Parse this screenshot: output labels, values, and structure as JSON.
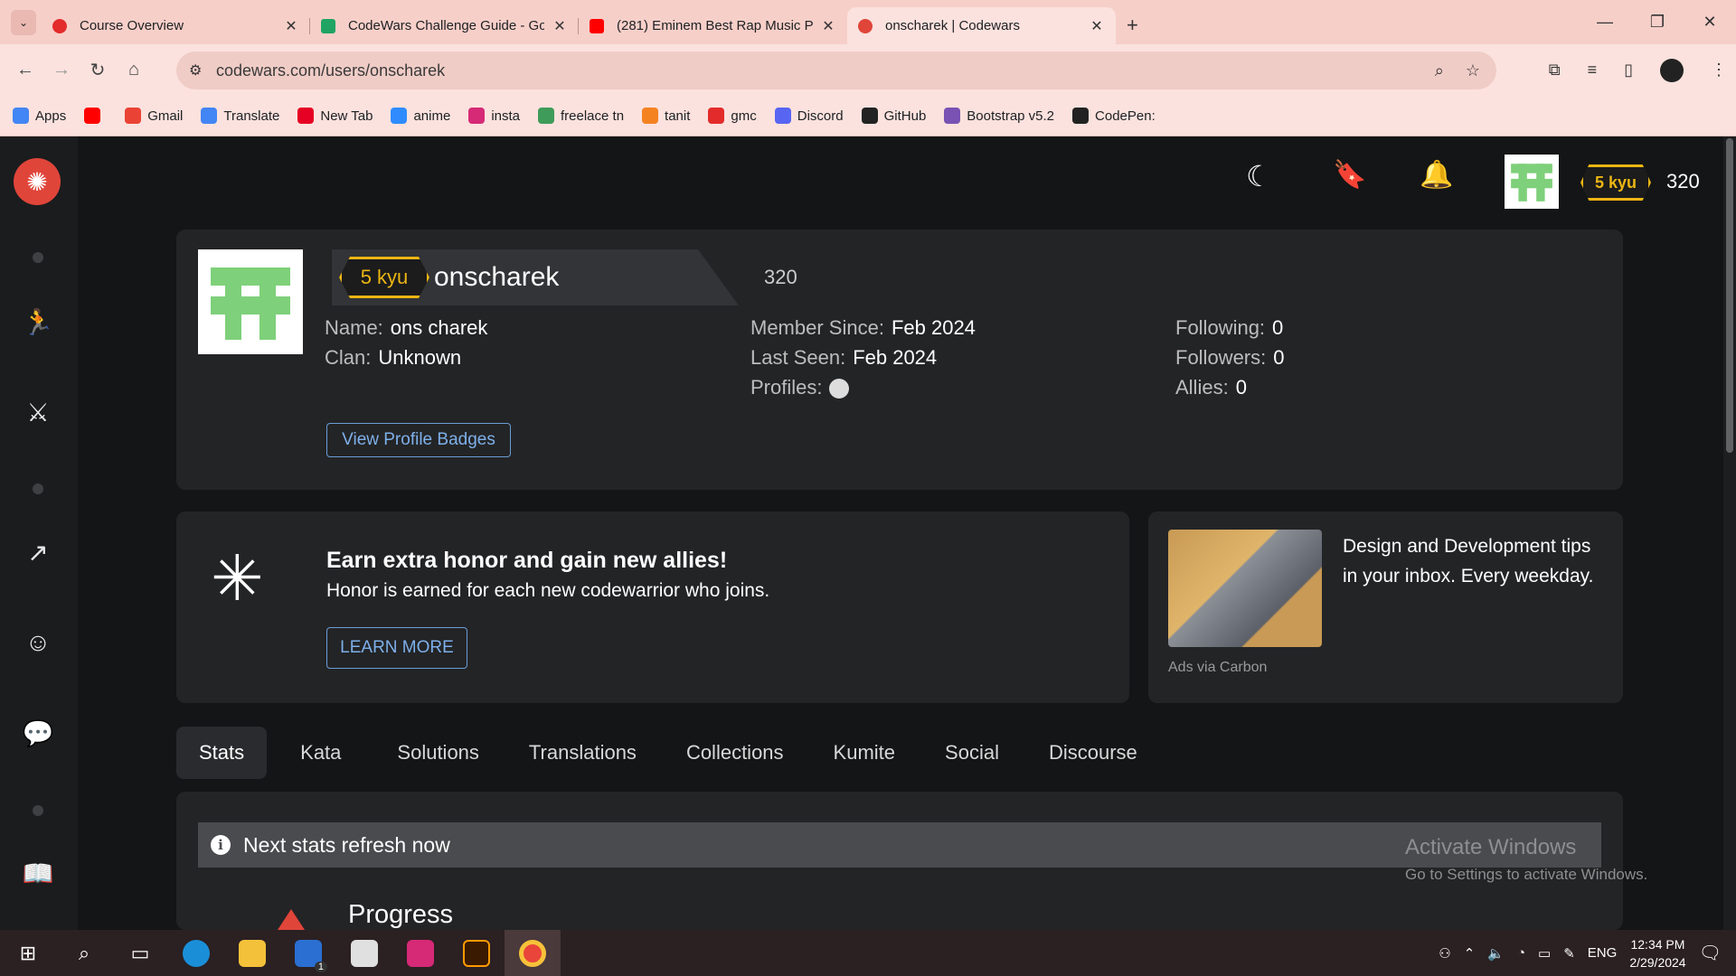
{
  "browser": {
    "tabs": [
      {
        "title": "Course Overview",
        "icon": "opera-red-icon",
        "color": "#e32b2b"
      },
      {
        "title": "CodeWars Challenge Guide - Go",
        "icon": "sheets-icon",
        "color": "#1fa463"
      },
      {
        "title": "(281) Eminem Best Rap Music P",
        "icon": "youtube-icon",
        "color": "#ff0000"
      },
      {
        "title": "onscharek | Codewars",
        "icon": "codewars-icon",
        "color": "#e0453a"
      }
    ],
    "url": "codewars.com/users/onscharek",
    "bookmarks": [
      {
        "label": "Apps",
        "color": "#4285f4"
      },
      {
        "label": "",
        "color": "#ff0000"
      },
      {
        "label": "Gmail",
        "color": "#ea4335"
      },
      {
        "label": "Translate",
        "color": "#4285f4"
      },
      {
        "label": "New Tab",
        "color": "#e60023"
      },
      {
        "label": "anime",
        "color": "#2f8cff"
      },
      {
        "label": "insta",
        "color": "#d62976"
      },
      {
        "label": "freelace tn",
        "color": "#3f9b5a"
      },
      {
        "label": "tanit",
        "color": "#f58220"
      },
      {
        "label": "gmc",
        "color": "#e32b2b"
      },
      {
        "label": "Discord",
        "color": "#5865f2"
      },
      {
        "label": "GitHub",
        "color": "#222222"
      },
      {
        "label": "Bootstrap v5.2",
        "color": "#7952b3"
      },
      {
        "label": "CodePen:",
        "color": "#222222"
      }
    ]
  },
  "header": {
    "rank": "5 kyu",
    "honor": "320"
  },
  "profile": {
    "rank": "5 kyu",
    "username": "onscharek",
    "honor": "320",
    "name_label": "Name:",
    "name_value": "ons charek",
    "clan_label": "Clan:",
    "clan_value": "Unknown",
    "member_label": "Member Since:",
    "member_value": "Feb 2024",
    "seen_label": "Last Seen:",
    "seen_value": "Feb 2024",
    "profiles_label": "Profiles:",
    "following_label": "Following:",
    "following_value": "0",
    "followers_label": "Followers:",
    "followers_value": "0",
    "allies_label": "Allies:",
    "allies_value": "0",
    "badges_button": "View Profile Badges"
  },
  "promo": {
    "title": "Earn extra honor and gain new allies!",
    "subtitle": "Honor is earned for each new codewarrior who joins.",
    "button": "LEARN MORE"
  },
  "ad": {
    "text": "Design and Development tips in your inbox. Every weekday.",
    "via": "Ads via Carbon"
  },
  "profile_tabs": [
    "Stats",
    "Kata",
    "Solutions",
    "Translations",
    "Collections",
    "Kumite",
    "Social",
    "Discourse"
  ],
  "stats": {
    "refresh": "Next stats refresh now",
    "progress_title": "Progress"
  },
  "watermark": {
    "title": "Activate Windows",
    "sub": "Go to Settings to activate Windows."
  },
  "taskbar": {
    "lang": "ENG",
    "time": "12:34 PM",
    "date": "2/29/2024",
    "mail_badge": "1"
  }
}
